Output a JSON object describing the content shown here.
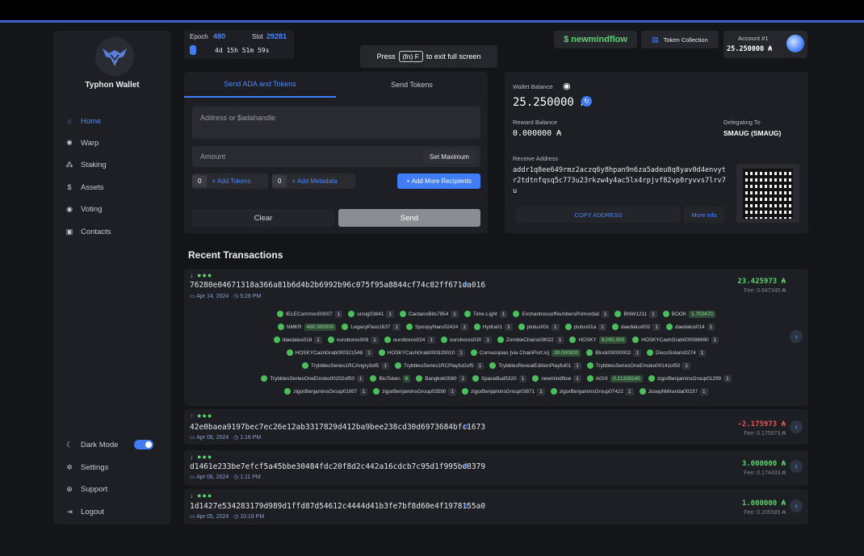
{
  "fullscreen": {
    "press": "Press",
    "key": "(fn) F",
    "rest": "to exit full screen"
  },
  "epoch": {
    "epoch_label": "Epoch",
    "epoch_value": "480",
    "slot_label": "Slot",
    "slot_value": "29281",
    "countdown": "4d 15h 51m 59s"
  },
  "header": {
    "handle": "$ newmindflow",
    "token_collection": "Token Collection",
    "account_label": "Account #1",
    "account_balance": "25.250000 ₳"
  },
  "sidebar": {
    "wallet_name": "Typhon Wallet",
    "items": [
      {
        "label": "Home",
        "icon": "home-icon"
      },
      {
        "label": "Warp",
        "icon": "warp-icon"
      },
      {
        "label": "Staking",
        "icon": "staking-icon"
      },
      {
        "label": "Assets",
        "icon": "assets-icon"
      },
      {
        "label": "Voting",
        "icon": "voting-icon"
      },
      {
        "label": "Contacts",
        "icon": "contacts-icon"
      }
    ],
    "bottom": [
      {
        "label": "Dark Mode",
        "icon": "moon-icon"
      },
      {
        "label": "Settings",
        "icon": "gear-icon"
      },
      {
        "label": "Support",
        "icon": "support-icon"
      },
      {
        "label": "Logout",
        "icon": "logout-icon"
      }
    ]
  },
  "send": {
    "tab_active": "Send ADA and Tokens",
    "tab_other": "Send Tokens",
    "address_placeholder": "Address or $adahandle",
    "amount_placeholder": "Amount",
    "set_max": "Set Maximum",
    "tokens_count": "0",
    "add_tokens": "+ Add Tokens",
    "metadata_count": "0",
    "add_metadata": "+ Add Metadata",
    "add_recipients": "+ Add More Recipients",
    "clear": "Clear",
    "send": "Send"
  },
  "balance": {
    "wallet_balance_label": "Wallet Balance",
    "wallet_balance": "25.250000 ₳",
    "reward_label": "Reward Balance",
    "reward": "0.000000 ₳",
    "delegating_label": "Delegating To",
    "delegating": "SMAUG (SMAUG)",
    "receive_label": "Receive Address",
    "address": "addr1q8ee649rmz2aczq6y8hpan9n6za5adeu8q8yav0d4envytr2tdtnfqsq5c773u23rkzw4y4ac5lx4rpjvf82vp0ryvvs7lrv7u",
    "copy": "COPY ADDRESS",
    "more_info": "More info"
  },
  "recent": {
    "title": "Recent Transactions",
    "txs": [
      {
        "dir": "↓",
        "hash": "76280e04671318a366a81b6d4b2b6992b96c075f95a8844cf74c82ff671da016",
        "date": "Apr 14, 2024",
        "time": "5:28 PM",
        "amount": "23.425973 ₳",
        "fee": "Fee: 0.647345 ₳"
      },
      {
        "dir": "↑",
        "hash": "42e0baea9197bec7ec26e12ab3317829d412ba9bee238cd30d6973684bfc1673",
        "date": "Apr 06, 2024",
        "time": "1:16 PM",
        "amount": "-2.175973 ₳",
        "fee": "Fee: 0.175973 ₳"
      },
      {
        "dir": "↓",
        "hash": "d1461e233be7efcf5a45bbe30484fdc20f8d2c442a16cdcb7c95d1f995bd8379",
        "date": "Apr 06, 2024",
        "time": "1:11 PM",
        "amount": "3.000000 ₳",
        "fee": "Fee: 0.174433 ₳"
      },
      {
        "dir": "↓",
        "hash": "1d1427e534283179d989d1ffd87d54612c4444d41b3fe7bf8d60e4f1978155a0",
        "date": "Apr 05, 2024",
        "time": "10:19 PM",
        "amount": "1.000000 ₳",
        "fee": "Fee: 0.205585 ₳"
      }
    ],
    "tokens": [
      [
        [
          "IELECommon00007",
          "1"
        ],
        [
          "unsig03841",
          "1"
        ],
        [
          "CardanoBits7854",
          "1"
        ],
        [
          "Time-Light",
          "1"
        ],
        [
          "EnchantressofNumbersPrimordial",
          "1"
        ],
        [
          "BNW1211",
          "1"
        ],
        [
          "BOOK",
          "1.702470"
        ]
      ],
      [
        [
          "NMKR",
          "480.000000"
        ],
        [
          "LegacyPass1637",
          "1"
        ],
        [
          "SpoopyNaru02424",
          "1"
        ],
        [
          "Hydra01",
          "1"
        ],
        [
          "plutus00c",
          "1"
        ],
        [
          "plutus01a",
          "1"
        ],
        [
          "daedalus002",
          "1"
        ],
        [
          "daedalus014",
          "1"
        ]
      ],
      [
        [
          "daedalus018",
          "1"
        ],
        [
          "ouroboros008",
          "1"
        ],
        [
          "ouroboros024",
          "1"
        ],
        [
          "ouroboros030",
          "1"
        ],
        [
          "ZombieChains09022",
          "1"
        ],
        [
          "HOSKY",
          "8,000,000"
        ],
        [
          "HOSKYCashGrab000086690",
          "1"
        ]
      ],
      [
        [
          "HOSKYCashGrab000321548",
          "1"
        ],
        [
          "HOSKYCashGrab000329010",
          "1"
        ],
        [
          "Cornucopias [via ChainPort.io]",
          "30.000000"
        ],
        [
          "Block00000002",
          "1"
        ],
        [
          "DiscoSolaris0274",
          "1"
        ]
      ],
      [
        [
          "TrybblesSeries1RCAngry3of5",
          "1"
        ],
        [
          "TrybblesSeries1RCPlayful2of5",
          "1"
        ],
        [
          "TrybblesRevealEditionPlayful01",
          "1"
        ],
        [
          "TrybblesSeriesOneEmoko00141of50",
          "1"
        ]
      ],
      [
        [
          "TrybblesSeriesOneEmoko00202of50",
          "1"
        ],
        [
          "BioToken",
          "6"
        ],
        [
          "Bangkok0080",
          "1"
        ],
        [
          "SpaceBud5320",
          "1"
        ],
        [
          "newmindflow",
          "1"
        ],
        [
          "AGIX",
          "0.21330240"
        ],
        [
          "zigorBenjaminsGroup01299",
          "1"
        ]
      ],
      [
        [
          "zigorBenjaminsGroup01807",
          "1"
        ],
        [
          "zigorBenjaminsGroup03590",
          "1"
        ],
        [
          "zigorBenjaminsGroup03871",
          "1"
        ],
        [
          "zigorBenjaminsGroup07422",
          "1"
        ],
        [
          "JosephMiranda00237",
          "1"
        ]
      ]
    ]
  }
}
